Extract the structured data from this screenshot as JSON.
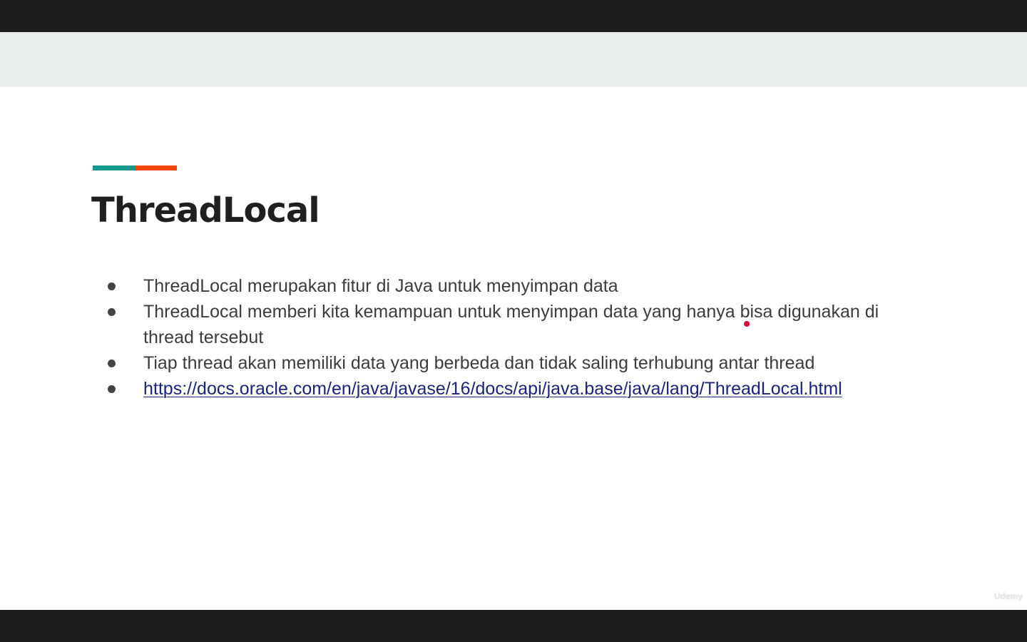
{
  "slide": {
    "title": "ThreadLocal",
    "accent_colors": [
      "#14998c",
      "#f0470f"
    ],
    "bullets": [
      {
        "text": "ThreadLocal merupakan fitur di Java untuk menyimpan data",
        "is_link": false
      },
      {
        "text": "ThreadLocal memberi kita kemampuan untuk menyimpan data yang hanya bisa digunakan di thread tersebut",
        "is_link": false
      },
      {
        "text": "Tiap thread akan memiliki data yang berbeda dan tidak saling terhubung antar thread",
        "is_link": false
      },
      {
        "text": "https://docs.oracle.com/en/java/javase/16/docs/api/java.base/java/lang/ThreadLocal.html",
        "is_link": true
      }
    ]
  },
  "player": {
    "watermark_label": "Udemy",
    "pointer_color": "#e0003c"
  }
}
